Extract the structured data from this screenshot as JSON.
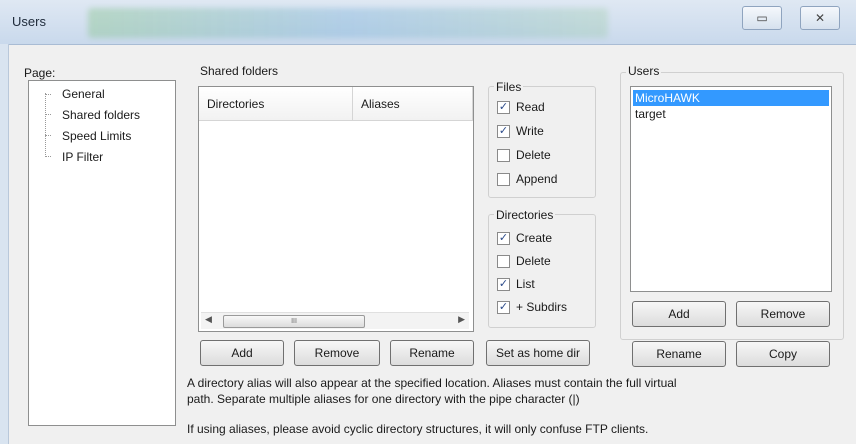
{
  "window": {
    "title": "Users",
    "buttons": {
      "restore": "▭",
      "close": "✕"
    }
  },
  "page_panel": {
    "label": "Page:",
    "items": [
      "General",
      "Shared folders",
      "Speed Limits",
      "IP Filter"
    ]
  },
  "shared_folders": {
    "label": "Shared folders",
    "columns": [
      "Directories",
      "Aliases"
    ],
    "scrollbar_thumb": "III",
    "buttons": {
      "add": "Add",
      "remove": "Remove",
      "rename": "Rename",
      "set_home": "Set as home dir"
    }
  },
  "files_group": {
    "label": "Files",
    "options": [
      {
        "label": "Read",
        "checked": true
      },
      {
        "label": "Write",
        "checked": true
      },
      {
        "label": "Delete",
        "checked": false
      },
      {
        "label": "Append",
        "checked": false
      }
    ]
  },
  "directories_group": {
    "label": "Directories",
    "options": [
      {
        "label": "Create",
        "checked": true
      },
      {
        "label": "Delete",
        "checked": false
      },
      {
        "label": "List",
        "checked": true
      },
      {
        "label": "+ Subdirs",
        "checked": true
      }
    ]
  },
  "users_panel": {
    "label": "Users",
    "items": [
      "MicroHAWK",
      "target"
    ],
    "selected_index": 0,
    "buttons": {
      "add": "Add",
      "remove": "Remove",
      "rename": "Rename",
      "copy": "Copy"
    }
  },
  "notes": {
    "line1": "A directory alias will also appear at the specified location. Aliases must contain the full virtual",
    "line2": "path. Separate multiple aliases for one directory with the pipe character (|)",
    "line3": "If using aliases, please avoid cyclic directory structures, it will only confuse FTP clients."
  },
  "colors": {
    "selection": "#3399ff",
    "checkmark": "#2b4a8a"
  }
}
